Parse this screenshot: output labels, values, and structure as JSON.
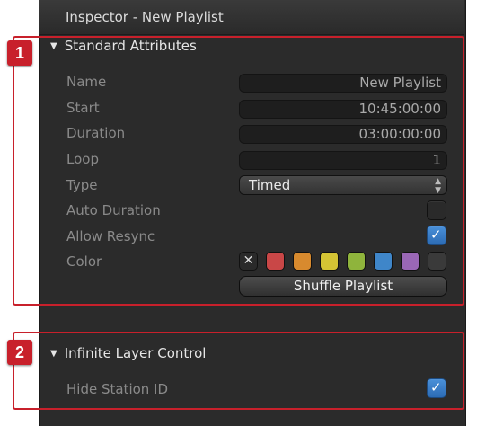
{
  "window": {
    "title": "Inspector - New Playlist"
  },
  "sections": [
    {
      "number": "1",
      "title": "Standard Attributes",
      "fields": {
        "name": {
          "label": "Name",
          "value": "New Playlist"
        },
        "start": {
          "label": "Start",
          "value": "10:45:00:00"
        },
        "duration": {
          "label": "Duration",
          "value": "03:00:00:00"
        },
        "loop": {
          "label": "Loop",
          "value": "1"
        },
        "type": {
          "label": "Type",
          "value": "Timed"
        },
        "auto_duration": {
          "label": "Auto Duration",
          "checked": false
        },
        "allow_resync": {
          "label": "Allow Resync",
          "checked": true
        },
        "color": {
          "label": "Color",
          "none_symbol": "✕",
          "swatches": [
            "#c94747",
            "#d88a2e",
            "#d4c434",
            "#8fb43c",
            "#3f86c9",
            "#9a67b6",
            "#3a3a3a"
          ]
        }
      },
      "shuffle_button": "Shuffle Playlist"
    },
    {
      "number": "2",
      "title": "Infinite Layer Control",
      "fields": {
        "hide_station_id": {
          "label": "Hide Station ID",
          "checked": true
        }
      }
    }
  ],
  "icons": {
    "disclosure": "▼",
    "checkmark": "✓",
    "select_arrows": "▲▼"
  },
  "colors": {
    "accent_red": "#c8202b",
    "panel_bg": "#2b2b2b",
    "check_blue": "#3b7fcc"
  }
}
